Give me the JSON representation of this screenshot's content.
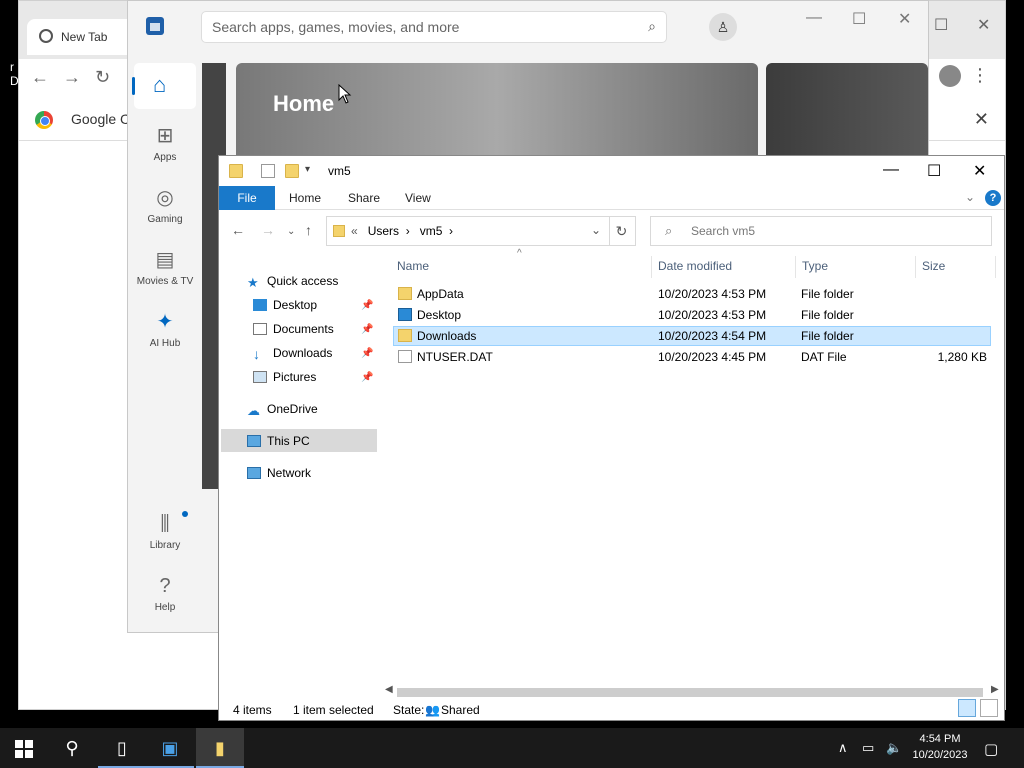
{
  "desktop": {
    "frag1": "r",
    "frag2": "D"
  },
  "chrome": {
    "tab_title": "New Tab",
    "bookmark_label": "Google Ch"
  },
  "store": {
    "search_placeholder": "Search apps, games, movies, and more",
    "nav": [
      {
        "label": "Apps"
      },
      {
        "label": "Gaming"
      },
      {
        "label": "Movies & TV"
      },
      {
        "label": "AI Hub"
      },
      {
        "label": "Library"
      },
      {
        "label": "Help"
      }
    ],
    "hero_title": "Home"
  },
  "explorer": {
    "title": "vm5",
    "ribbon_tabs": [
      "File",
      "Home",
      "Share",
      "View"
    ],
    "breadcrumbs": [
      "Users",
      "vm5"
    ],
    "search_placeholder": "Search vm5",
    "nav_pane": {
      "quick_access": "Quick access",
      "pinned": [
        "Desktop",
        "Documents",
        "Downloads",
        "Pictures"
      ],
      "onedrive": "OneDrive",
      "this_pc": "This PC",
      "network": "Network"
    },
    "columns": [
      "Name",
      "Date modified",
      "Type",
      "Size"
    ],
    "files": [
      {
        "name": "AppData",
        "date": "10/20/2023 4:53 PM",
        "type": "File folder",
        "size": ""
      },
      {
        "name": "Desktop",
        "date": "10/20/2023 4:53 PM",
        "type": "File folder",
        "size": ""
      },
      {
        "name": "Downloads",
        "date": "10/20/2023 4:54 PM",
        "type": "File folder",
        "size": ""
      },
      {
        "name": "NTUSER.DAT",
        "date": "10/20/2023 4:45 PM",
        "type": "DAT File",
        "size": "1,280 KB"
      }
    ],
    "status": {
      "count": "4 items",
      "selected": "1 item selected",
      "state_label": "State:",
      "state_value": "Shared"
    }
  },
  "taskbar": {
    "time": "4:54 PM",
    "date": "10/20/2023"
  },
  "colors": {
    "accent": "#0067c0",
    "ribbon_file": "#1979ca",
    "selection": "#cce8ff"
  }
}
